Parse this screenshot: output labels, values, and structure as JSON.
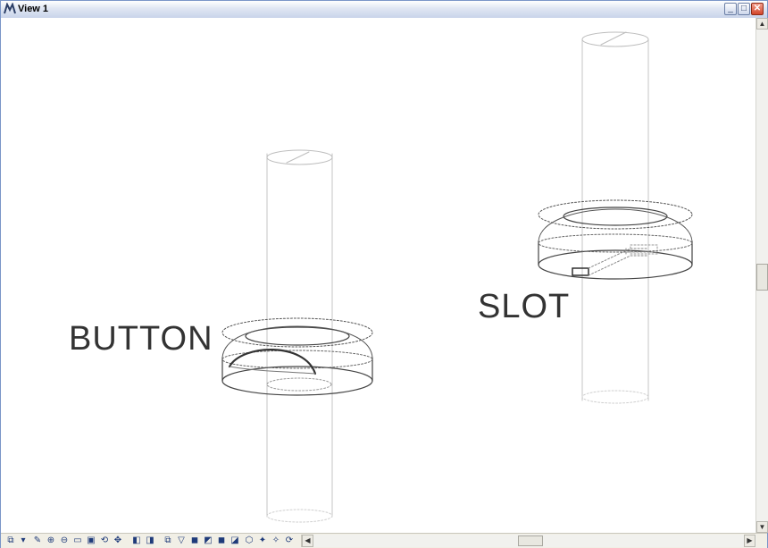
{
  "window": {
    "title": "View 1",
    "minimize": "_",
    "maximize": "□",
    "close": "✕"
  },
  "labels": {
    "button": "BUTTON",
    "slot": "SLOT"
  },
  "scroll": {
    "up": "▲",
    "down": "▼",
    "left": "◀",
    "right": "▶"
  },
  "toolbar": {
    "icons": [
      {
        "name": "view-attributes-icon",
        "glyph": "⧉"
      },
      {
        "name": "dropdown-arrow-icon",
        "glyph": "▾"
      },
      {
        "name": "update-view-icon",
        "glyph": "✎"
      },
      {
        "name": "zoom-in-icon",
        "glyph": "⊕"
      },
      {
        "name": "zoom-out-icon",
        "glyph": "⊖"
      },
      {
        "name": "window-area-icon",
        "glyph": "▭"
      },
      {
        "name": "fit-view-icon",
        "glyph": "▣"
      },
      {
        "name": "rotate-view-icon",
        "glyph": "⟲"
      },
      {
        "name": "pan-view-icon",
        "glyph": "✥"
      },
      {
        "name": "view-previous-icon",
        "glyph": "◧"
      },
      {
        "name": "view-next-icon",
        "glyph": "◨"
      },
      {
        "name": "copy-view-icon",
        "glyph": "⧉"
      },
      {
        "name": "clip-volume-icon",
        "glyph": "▽"
      },
      {
        "name": "display-style-icon",
        "glyph": "◼"
      },
      {
        "name": "saved-view-icon",
        "glyph": "◩"
      },
      {
        "name": "camera-icon",
        "glyph": "◼"
      },
      {
        "name": "render-icon",
        "glyph": "◪"
      },
      {
        "name": "display-icon",
        "glyph": "⬡"
      },
      {
        "name": "lighting-icon",
        "glyph": "✦"
      },
      {
        "name": "select-tool-icon",
        "glyph": "✧"
      },
      {
        "name": "refresh-icon",
        "glyph": "⟳"
      }
    ]
  },
  "colors": {
    "accent": "#2b3e66",
    "lines": "#444444",
    "ghost": "#bdbdbd"
  }
}
